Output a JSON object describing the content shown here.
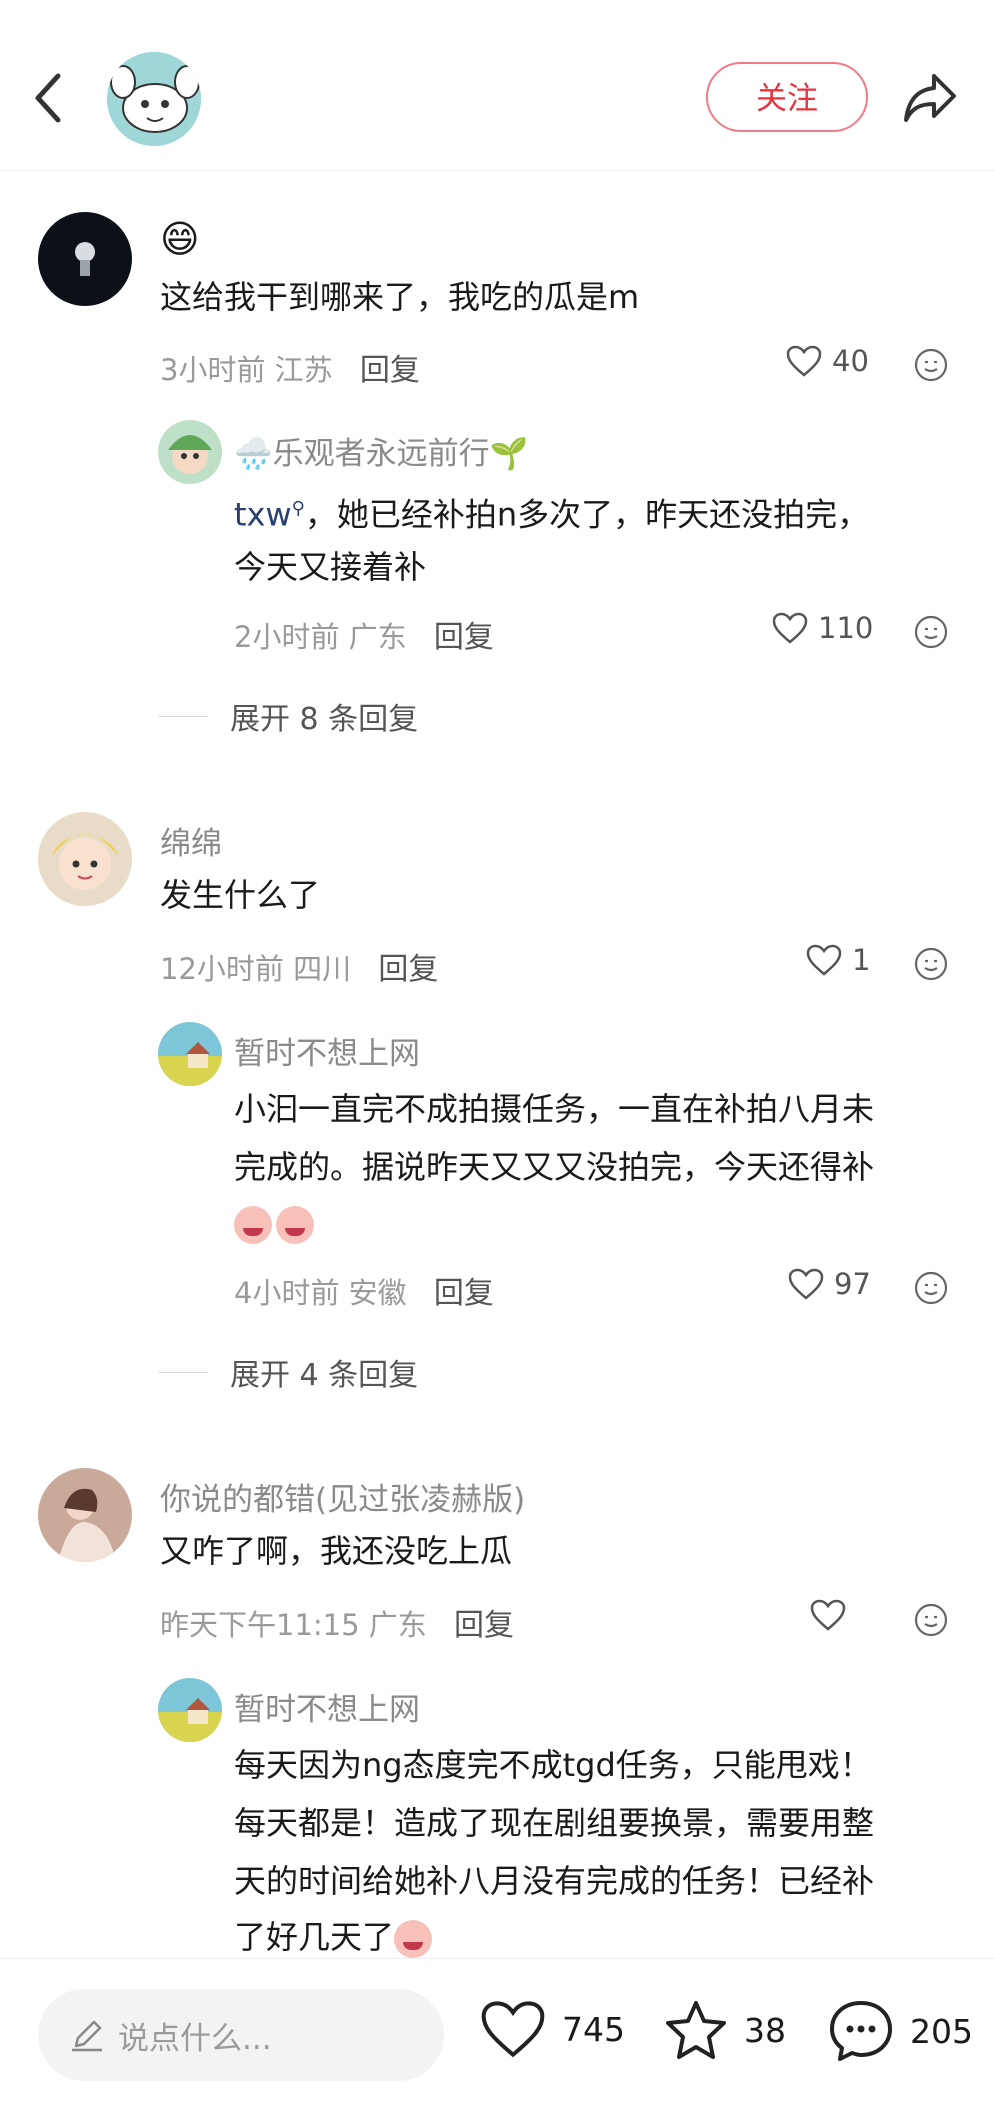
{
  "header": {
    "follow_label": "关注",
    "icons": [
      "back-icon",
      "avatar",
      "share-icon"
    ]
  },
  "comments": [
    {
      "username": "",
      "emoji": "😄",
      "text": "这给我干到哪来了，我吃的瓜是m",
      "time": "3小时前",
      "location": "江苏",
      "reply_label": "回复",
      "likes": "40",
      "replies": [
        {
          "username": "🌧️乐观者永远前行🌱",
          "mention": "txw",
          "text_line1": "，她已经补拍n多次了，昨天还没拍完，",
          "text_line2": "今天又接着补",
          "time": "2小时前",
          "location": "广东",
          "reply_label": "回复",
          "likes": "110"
        }
      ],
      "expand_label": "展开 8 条回复"
    },
    {
      "username": "绵绵",
      "text": "发生什么了",
      "time": "12小时前",
      "location": "四川",
      "reply_label": "回复",
      "likes": "1",
      "replies": [
        {
          "username": "暂时不想上网",
          "text_line1": "小汩一直完不成拍摄任务，一直在补拍八月未",
          "text_line2": "完成的。据说昨天又又又没拍完，今天还得补",
          "time": "4小时前",
          "location": "安徽",
          "reply_label": "回复",
          "likes": "97"
        }
      ],
      "expand_label": "展开 4 条回复"
    },
    {
      "username": "你说的都错(见过张凌赫版)",
      "text": "又咋了啊，我还没吃上瓜",
      "time": "昨天下午11:15",
      "location": "广东",
      "reply_label": "回复",
      "likes": "",
      "replies": [
        {
          "username": "暂时不想上网",
          "text_line1": "每天因为ng态度完不成tgd任务，只能甩戏！",
          "text_line2": "每天都是！造成了现在剧组要换景，需要用整",
          "text_line3": "天的时间给她补八月没有完成的任务！已经补",
          "text_line4": "了好几天了"
        }
      ]
    }
  ],
  "bottom": {
    "placeholder": "说点什么...",
    "likes": "745",
    "stars": "38",
    "comments": "205"
  }
}
